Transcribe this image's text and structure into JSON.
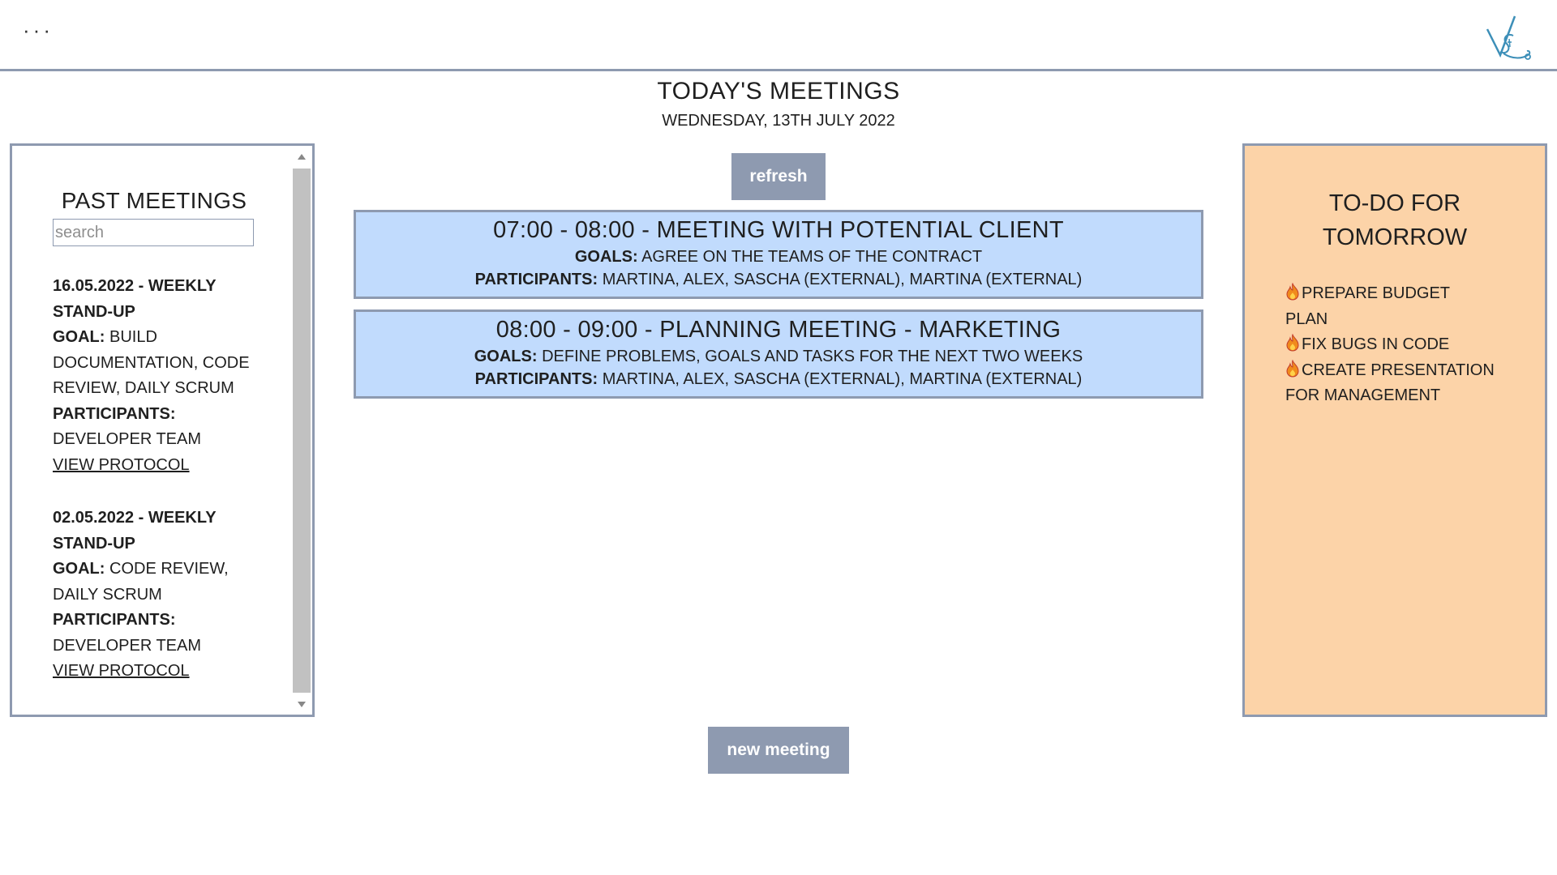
{
  "header": {
    "menu_icon": "ellipsis-icon",
    "logo": "vs-logo"
  },
  "page": {
    "title": "TODAY'S MEETINGS",
    "date": "WEDNESDAY, 13TH JULY 2022"
  },
  "actions": {
    "refresh_label": "refresh",
    "new_meeting_label": "new meeting"
  },
  "past_meetings": {
    "title": "PAST MEETINGS",
    "search_placeholder": "search",
    "items": [
      {
        "heading": "16.05.2022 - WEEKLY STAND-UP",
        "goal_label": "GOAL:",
        "goal": "BUILD DOCUMENTATION, CODE REVIEW, DAILY SCRUM",
        "participants_label": "PARTICIPANTS:",
        "participants": "DEVELOPER TEAM",
        "link": "VIEW PROTOCOL"
      },
      {
        "heading": "02.05.2022 - WEEKLY STAND-UP",
        "goal_label": "GOAL:",
        "goal": "CODE REVIEW, DAILY SCRUM",
        "participants_label": "PARTICIPANTS:",
        "participants": "DEVELOPER TEAM",
        "link": "VIEW PROTOCOL"
      }
    ]
  },
  "meetings": [
    {
      "heading": "07:00 - 08:00 - MEETING WITH POTENTIAL CLIENT",
      "goals_label": "GOALS:",
      "goals": "AGREE ON THE TEAMS OF THE CONTRACT",
      "participants_label": "PARTICIPANTS:",
      "participants": "MARTINA, ALEX, SASCHA (EXTERNAL), MARTINA (EXTERNAL)"
    },
    {
      "heading": "08:00 - 09:00 - PLANNING MEETING - MARKETING",
      "goals_label": "GOALS:",
      "goals": "DEFINE PROBLEMS, GOALS AND TASKS FOR THE NEXT TWO WEEKS",
      "participants_label": "PARTICIPANTS:",
      "participants": "MARTINA, ALEX, SASCHA (EXTERNAL), MARTINA (EXTERNAL)"
    }
  ],
  "todo": {
    "title_line1": "TO-DO FOR",
    "title_line2": "TOMORROW",
    "item_icon": "fire-icon",
    "items": [
      "PREPARE BUDGET PLAN",
      "FIX BUGS IN CODE",
      "CREATE PRESENTATION FOR MANAGEMENT"
    ]
  },
  "colors": {
    "accent": "#8e9ab0",
    "meeting_bg": "#c1dbfd",
    "todo_bg": "#fcd3a8"
  }
}
